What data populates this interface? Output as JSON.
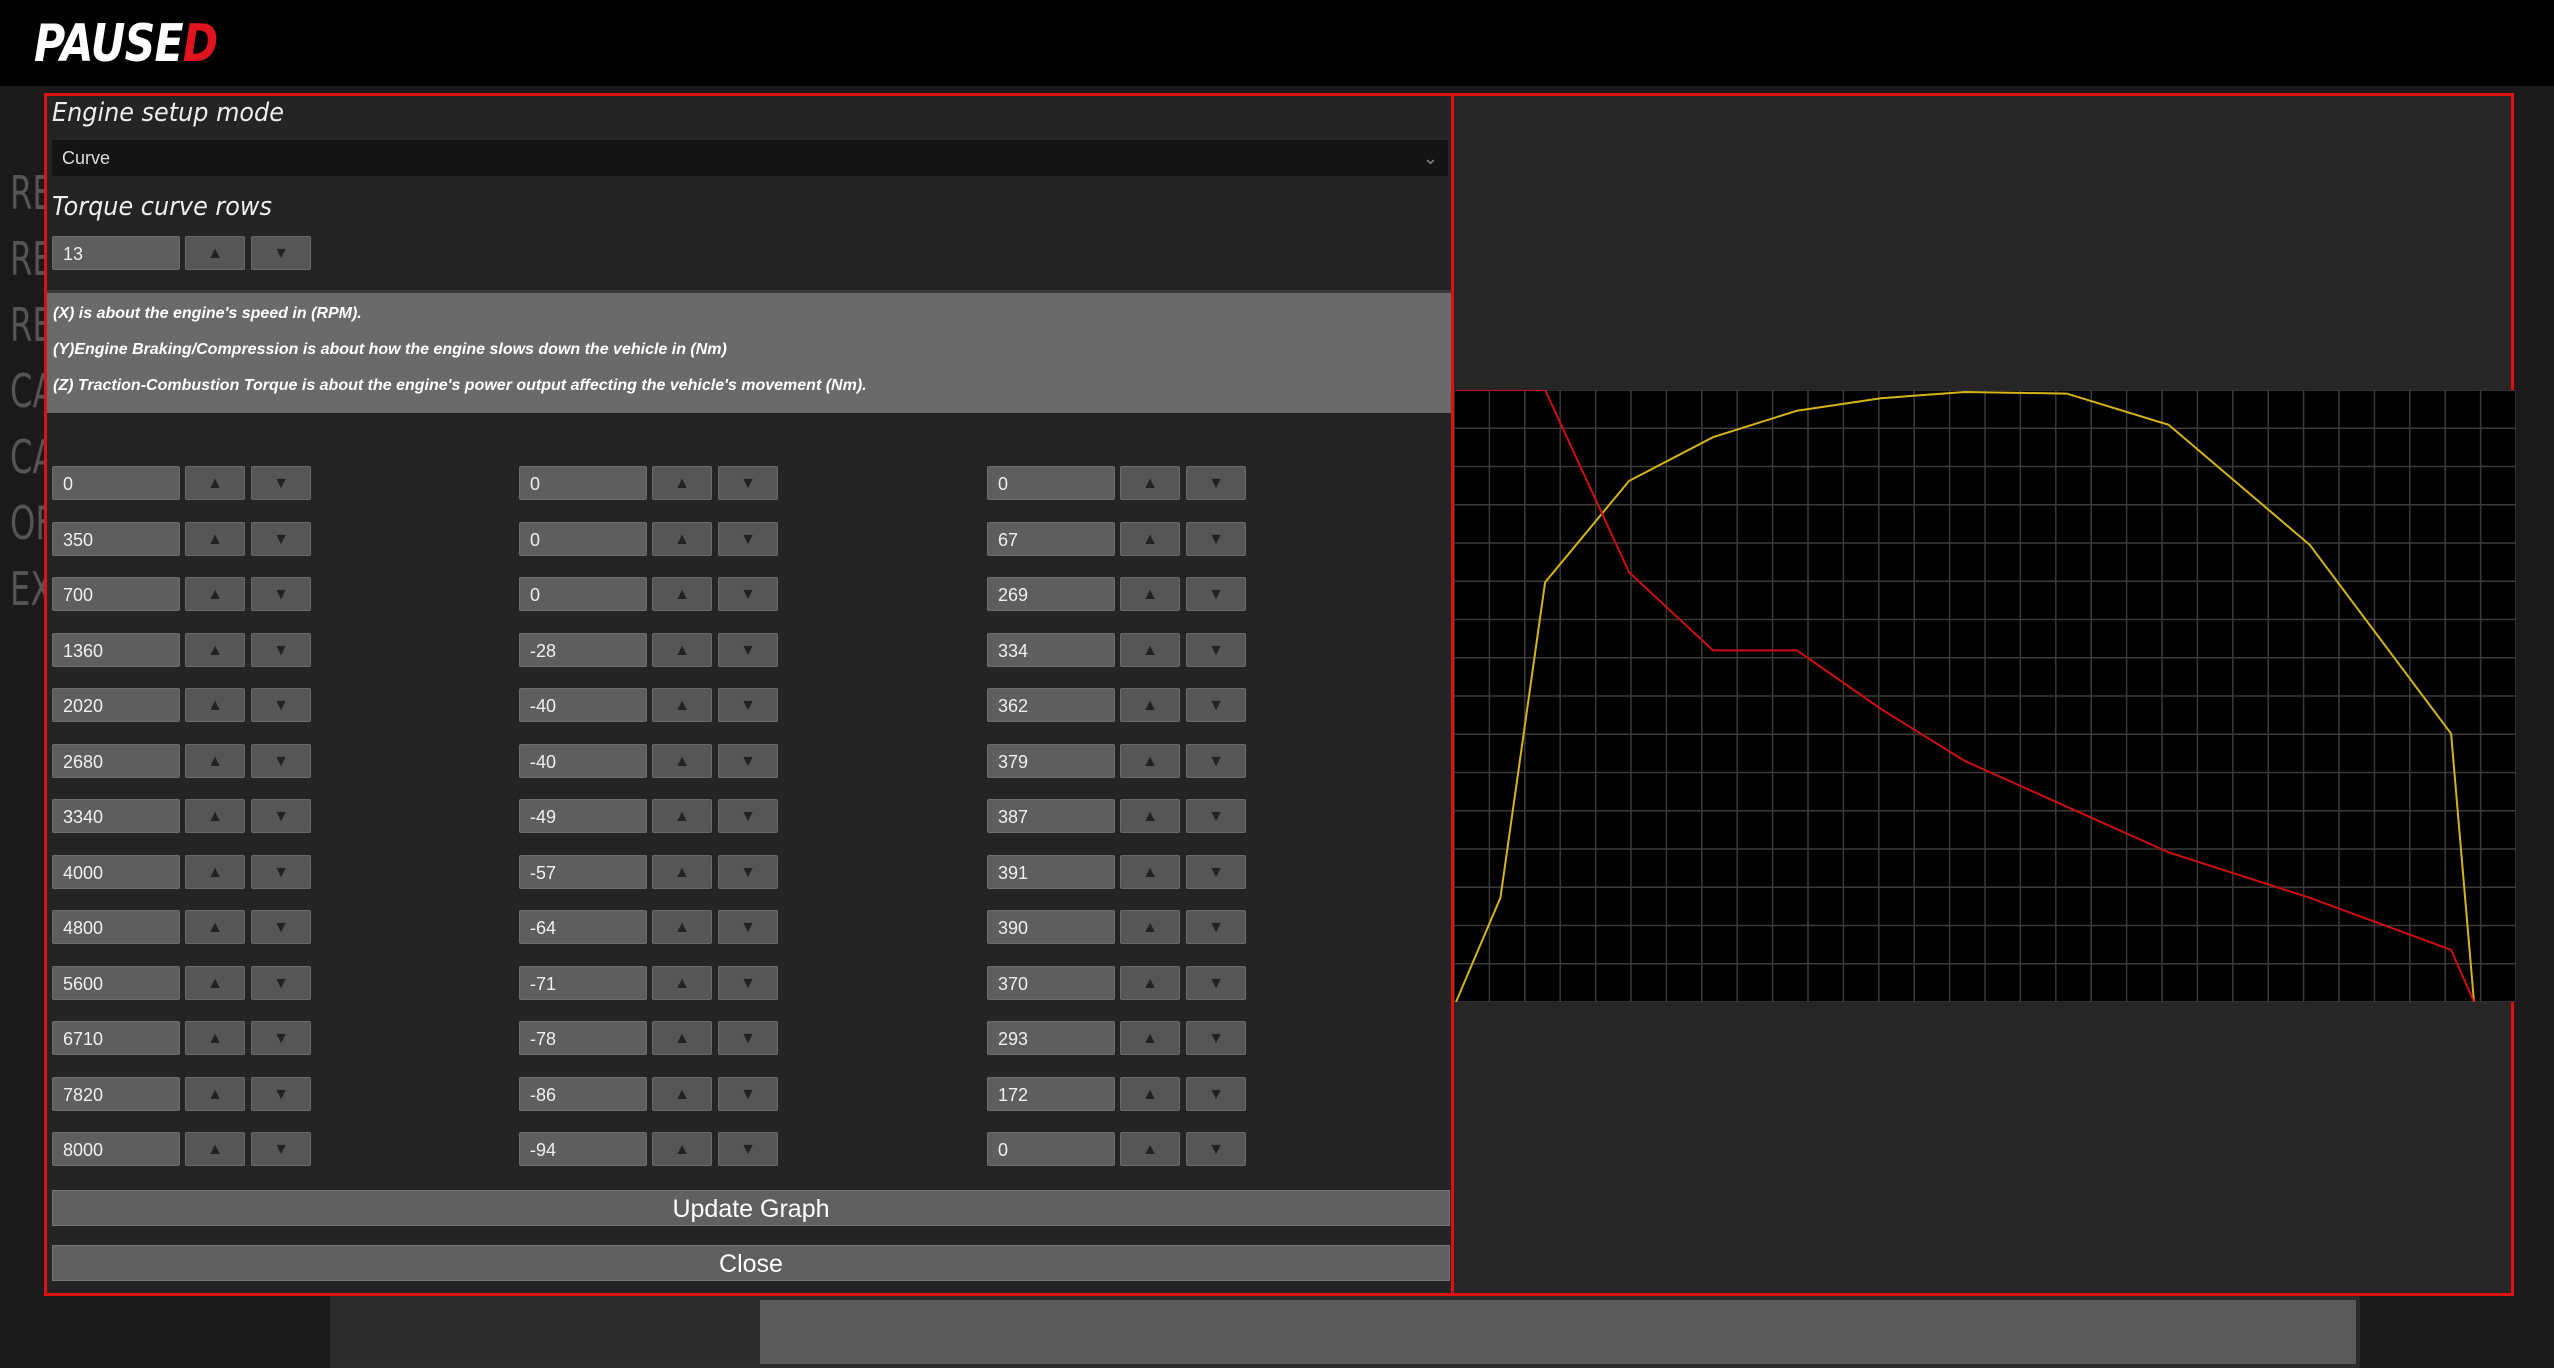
{
  "header": {
    "logo_main": "PAUSE",
    "logo_accent": "D",
    "accent_color": "#e0141e"
  },
  "background_menu": [
    "RE",
    "RE",
    "RE",
    "CA",
    "CA",
    "OF",
    "EX"
  ],
  "dialog": {
    "border_color": "#dd1111",
    "engine_setup_title": "Engine setup mode",
    "engine_setup_value": "Curve",
    "rows_title": "Torque curve rows",
    "rows_value": "13",
    "info": {
      "line1": "(X) is about the engine's speed in (RPM).",
      "line2": "(Y)Engine Braking/Compression  is about how the engine slows down the vehicle in (Nm)",
      "line3": "(Z) Traction-Combustion Torque  is about the engine's power output affecting the vehicle's movement (Nm)."
    },
    "up_glyph": "▲",
    "down_glyph": "▼",
    "x_values": [
      "0",
      "350",
      "700",
      "1360",
      "2020",
      "2680",
      "3340",
      "4000",
      "4800",
      "5600",
      "6710",
      "7820",
      "8000"
    ],
    "y_values": [
      "0",
      "0",
      "0",
      "-28",
      "-40",
      "-40",
      "-49",
      "-57",
      "-64",
      "-71",
      "-78",
      "-86",
      "-94"
    ],
    "z_values": [
      "0",
      "67",
      "269",
      "334",
      "362",
      "379",
      "387",
      "391",
      "390",
      "370",
      "293",
      "172",
      "0"
    ],
    "update_label": "Update Graph",
    "close_label": "Close"
  },
  "chart_data": {
    "type": "line",
    "x": [
      0,
      350,
      700,
      1360,
      2020,
      2680,
      3340,
      4000,
      4800,
      5600,
      6710,
      7820,
      8000
    ],
    "series": [
      {
        "values": [
          0,
          67,
          269,
          334,
          362,
          379,
          387,
          391,
          390,
          370,
          293,
          172,
          0
        ],
        "color": "#d4b41a"
      },
      {
        "values": [
          0,
          0,
          0,
          -28,
          -40,
          -40,
          -49,
          -57,
          -64,
          -71,
          -78,
          -86,
          -94
        ],
        "color": "#cc1010"
      }
    ],
    "grid": true,
    "background": "#000000"
  }
}
